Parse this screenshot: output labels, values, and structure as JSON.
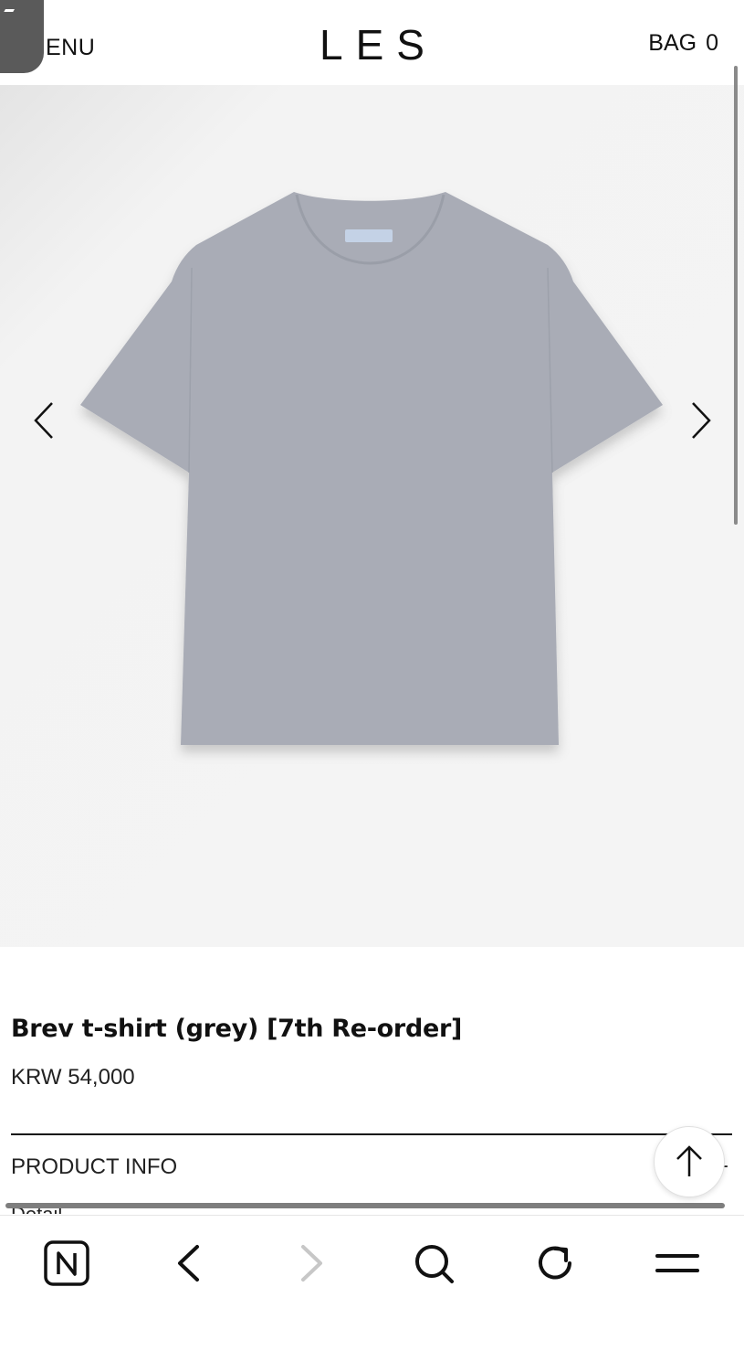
{
  "header": {
    "menu_label": "ENU",
    "logo": "LES",
    "bag_label": "BAG",
    "bag_count": "0"
  },
  "gallery": {
    "shirt_color": "#a9acb6",
    "background": "#f4f4f4"
  },
  "product": {
    "title": "Brev t-shirt (grey) [7th Re-order]",
    "price": "KRW 54,000"
  },
  "info_section": {
    "label": "PRODUCT INFO",
    "toggle": "-",
    "next_label": "Detail"
  },
  "toolbar": {
    "icons": [
      "naver-home-icon",
      "back-icon",
      "forward-icon",
      "search-icon",
      "refresh-icon",
      "menu-icon"
    ]
  }
}
